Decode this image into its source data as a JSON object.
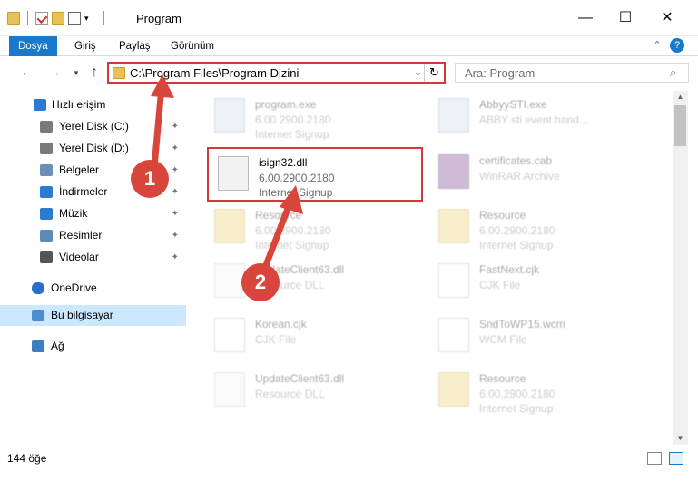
{
  "window": {
    "title": "Program",
    "minimize": "—",
    "maximize": "☐",
    "close": "✕"
  },
  "ribbon": {
    "tabs": [
      "Dosya",
      "Giriş",
      "Paylaş",
      "Görünüm"
    ],
    "collapse": "⌃",
    "help": "?"
  },
  "nav": {
    "back": "←",
    "forward": "→",
    "recent": "▾",
    "up": "↑",
    "address": "C:\\Program Files\\Program Dizini",
    "address_dropdown": "⌄",
    "refresh": "↻",
    "search_placeholder": "Ara: Program"
  },
  "sidebar": {
    "items": [
      {
        "label": "Hızlı erişim",
        "icon": "star-icon",
        "pinned": false
      },
      {
        "label": "Yerel Disk (C:)",
        "icon": "drive-icon",
        "pinned": true
      },
      {
        "label": "Yerel Disk (D:)",
        "icon": "drive-icon",
        "pinned": true
      },
      {
        "label": "Belgeler",
        "icon": "documents-icon",
        "pinned": true
      },
      {
        "label": "İndirmeler",
        "icon": "download-icon",
        "pinned": true
      },
      {
        "label": "Müzik",
        "icon": "music-icon",
        "pinned": true
      },
      {
        "label": "Resimler",
        "icon": "pictures-icon",
        "pinned": true
      },
      {
        "label": "Videolar",
        "icon": "video-icon",
        "pinned": true
      },
      {
        "label": "OneDrive",
        "icon": "cloud-icon",
        "pinned": false
      },
      {
        "label": "Bu bilgisayar",
        "icon": "computer-icon",
        "pinned": false,
        "selected": true
      },
      {
        "label": "Ağ",
        "icon": "network-icon",
        "pinned": false
      }
    ],
    "pin_glyph": "📌"
  },
  "files": [
    {
      "name": "program.exe",
      "line1": "6.00.2900.2180",
      "line2": "Internet Signup",
      "icon": "exe-icon",
      "dim": true
    },
    {
      "name": "AbbyySTI.exe",
      "line1": "ABBY sti event hand...",
      "line2": "",
      "icon": "exe-icon",
      "dim": true
    },
    {
      "name": "isign32.dll",
      "line1": "6.00.2900.2180",
      "line2": "Internet Signup",
      "icon": "dll-gear-icon",
      "dim": false,
      "highlight": true
    },
    {
      "name": "certificates.cab",
      "line1": "WinRAR Archive",
      "line2": "",
      "icon": "rar-icon",
      "dim": true
    },
    {
      "name": "Resource",
      "line1": "6.00.2900.2180",
      "line2": "Internet Signup",
      "icon": "folder-icon",
      "dim": true
    },
    {
      "name": "Resource",
      "line1": "6.00.2900.2180",
      "line2": "Internet Signup",
      "icon": "folder-icon",
      "dim": true
    },
    {
      "name": "UpdateClient63.dll",
      "line1": "Resource DLL",
      "line2": "",
      "icon": "dll-gear-icon",
      "dim": true
    },
    {
      "name": "FastNext.cjk",
      "line1": "CJK File",
      "line2": "",
      "icon": "document-icon",
      "dim": true
    },
    {
      "name": "Korean.cjk",
      "line1": "CJK File",
      "line2": "",
      "icon": "document-icon",
      "dim": true
    },
    {
      "name": "SndToWP15.wcm",
      "line1": "WCM File",
      "line2": "",
      "icon": "document-icon",
      "dim": true
    },
    {
      "name": "UpdateClient63.dll",
      "line1": "Resource DLL",
      "line2": "",
      "icon": "dll-gear-icon",
      "dim": true
    },
    {
      "name": "Resource",
      "line1": "6.00.2900.2180",
      "line2": "Internet Signup",
      "icon": "folder-icon",
      "dim": true
    }
  ],
  "status": {
    "count": "144 öğe"
  },
  "callouts": [
    "1",
    "2"
  ]
}
